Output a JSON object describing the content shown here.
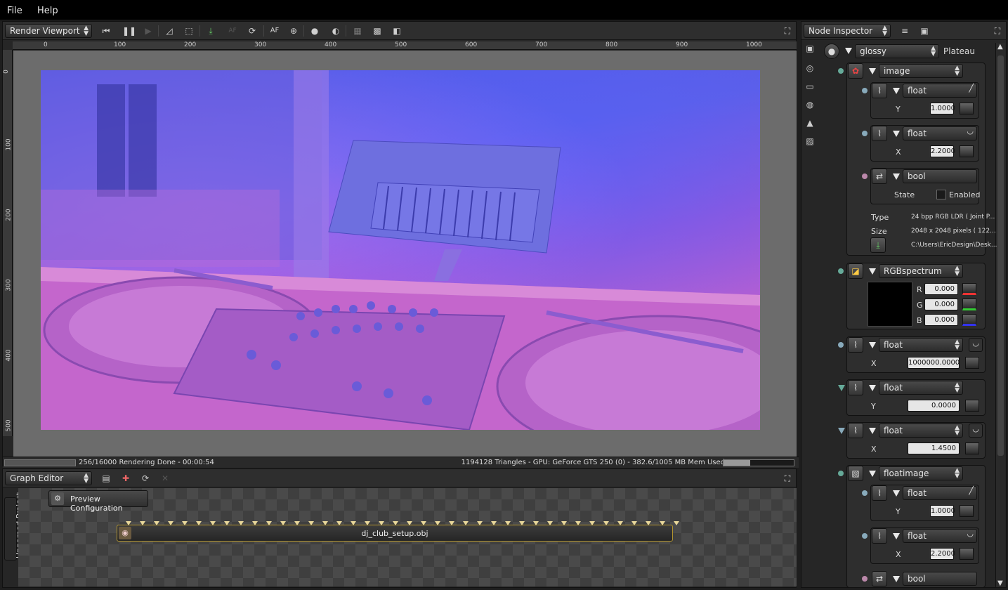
{
  "menu": {
    "file": "File",
    "help": "Help"
  },
  "viewport": {
    "mode": "Render Viewport",
    "ruler_h": [
      "0",
      "100",
      "200",
      "300",
      "400",
      "500",
      "600",
      "700",
      "800",
      "900",
      "1000"
    ],
    "ruler_v": [
      "0",
      "100",
      "200",
      "300",
      "400",
      "500"
    ],
    "status_left": "256/16000 Rendering Done - 00:00:54",
    "status_right": "1194128 Triangles - GPU: GeForce GTS 250 (0) - 382.6/1005 MB Mem Used",
    "render_progress": 1.0,
    "mem_used_fraction": 0.38
  },
  "graph": {
    "mode": "Graph Editor",
    "preview_label": "Preview Configuration",
    "project_tab": "Unnamed Project",
    "node_label": "dj_club_setup.obj"
  },
  "inspector": {
    "mode": "Node Inspector",
    "material": "glossy",
    "material_name": "Plateau",
    "image_node": "image",
    "float1": {
      "type": "float",
      "label": "Y",
      "value": "1.0000"
    },
    "float2": {
      "type": "float",
      "label": "X",
      "value": "2.2000"
    },
    "bool1": {
      "type": "bool",
      "label": "State",
      "check": "Enabled"
    },
    "info": {
      "type_label": "Type",
      "type_value": "24 bpp RGB LDR ( Joint P...",
      "size_label": "Size",
      "size_value": "2048 x 2048 pixels ( 122...",
      "path_value": "C:\\Users\\EricDesign\\Desk..."
    },
    "rgb": {
      "type": "RGBspectrum",
      "r_label": "R",
      "r": "0.000",
      "g_label": "G",
      "g": "0.000",
      "b_label": "B",
      "b": "0.000"
    },
    "float3": {
      "type": "float",
      "label": "X",
      "value": "1000000.0000"
    },
    "float4": {
      "type": "float",
      "label": "Y",
      "value": "0.0000"
    },
    "float5": {
      "type": "float",
      "label": "X",
      "value": "1.4500"
    },
    "floatimage": "floatimage",
    "float6": {
      "type": "float",
      "label": "Y",
      "value": "1.0000"
    },
    "float7": {
      "type": "float",
      "label": "X",
      "value": "2.2000"
    },
    "bool2": {
      "type": "bool"
    }
  },
  "colors": {
    "accent_node_border": "#b3952f",
    "pin": "#e8d79a"
  }
}
